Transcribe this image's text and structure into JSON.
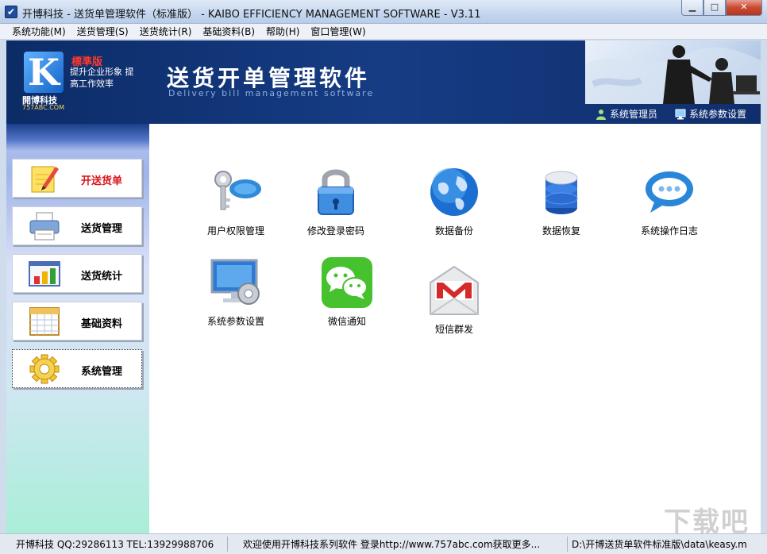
{
  "window": {
    "title": "开博科技 - 送货单管理软件（标准版） - KAIBO EFFICIENCY MANAGEMENT SOFTWARE - V3.11",
    "minimize_glyph": "▁",
    "maximize_glyph": "□",
    "close_glyph": "✕"
  },
  "menu": [
    {
      "label": "系统功能(M)"
    },
    {
      "label": "送货管理(S)"
    },
    {
      "label": "送货统计(R)"
    },
    {
      "label": "基础资料(B)"
    },
    {
      "label": "帮助(H)"
    },
    {
      "label": "窗口管理(W)"
    }
  ],
  "banner": {
    "logo_letter": "K",
    "logo_company": "開博科技",
    "logo_url": "757ABC.COM",
    "edition": "標準版",
    "slogan": "提升企业形象 提高工作效率",
    "title": "送货开单管理软件",
    "subtitle": "Delivery bill management software",
    "user_label": "系统管理员",
    "settings_label": "系统参数设置"
  },
  "sidebar": {
    "items": [
      {
        "label": "开送货单",
        "icon": "pencil-note-icon",
        "active": false,
        "color": "#d8141a"
      },
      {
        "label": "送货管理",
        "icon": "printer-icon",
        "active": false,
        "color": "#000000"
      },
      {
        "label": "送货统计",
        "icon": "bar-chart-icon",
        "active": false,
        "color": "#000000"
      },
      {
        "label": "基础资料",
        "icon": "calendar-grid-icon",
        "active": false,
        "color": "#000000"
      },
      {
        "label": "系统管理",
        "icon": "gear-icon",
        "active": true,
        "color": "#000000"
      }
    ]
  },
  "main": {
    "tiles": [
      {
        "label": "用户权限管理",
        "icon": "keys-icon"
      },
      {
        "label": "修改登录密码",
        "icon": "padlock-icon"
      },
      {
        "label": "数据备份",
        "icon": "globe-icon"
      },
      {
        "label": "数据恢复",
        "icon": "database-icon"
      },
      {
        "label": "系统操作日志",
        "icon": "chat-bubble-icon"
      },
      {
        "label": "系统参数设置",
        "icon": "monitor-gear-icon"
      },
      {
        "label": "微信通知",
        "icon": "wechat-icon"
      },
      {
        "label": "短信群发",
        "icon": "mail-envelope-icon"
      }
    ]
  },
  "status": {
    "company": "开博科技 QQ:29286113 TEL:13929988706",
    "welcome": "欢迎使用开博科技系列软件   登录http://www.757abc.com获取更多...",
    "path": "D:\\开博送货单软件标准版\\data\\keasy.m"
  },
  "watermark": "下载吧",
  "colors": {
    "banner": "#163c84",
    "accent_red": "#d8141a",
    "panel_bg": "#ffffff"
  }
}
